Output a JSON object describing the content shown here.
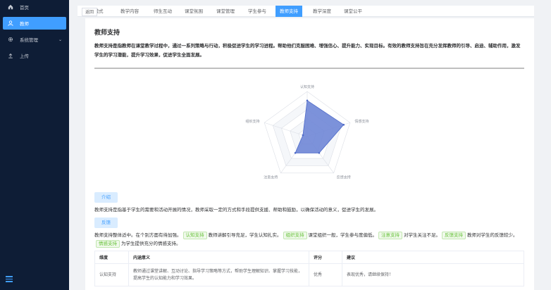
{
  "sidebar": {
    "items": [
      {
        "label": "首页",
        "icon": "home-icon"
      },
      {
        "label": "教师",
        "icon": "user-icon"
      },
      {
        "label": "系统管理",
        "icon": "gear-icon"
      },
      {
        "label": "上传",
        "icon": "upload-icon"
      }
    ]
  },
  "tabs": [
    "学模式",
    "教学内容",
    "师生互动",
    "课堂氛围",
    "课堂管理",
    "学生参与",
    "教师支持",
    "教学深度",
    "课堂公平"
  ],
  "return_label": "返回",
  "page": {
    "title": "教师支持",
    "description": "教师支持是指教师在课堂教学过程中，通过一系列策略与行动，积极促进学生的学习进程。帮助他们克服困难、增强信心、提升能力、实现目标。有效的教师支持旨在充分发挥教师的引导、启迪、辅助作用，激发学生的学习潜能，提升学习效果，促进学生全面发展。"
  },
  "chart_data": {
    "type": "radar",
    "axes": [
      "认知支持",
      "情感支持",
      "反馈支持",
      "注意支持",
      "组织支持"
    ],
    "values": [
      0.8,
      0.85,
      0.45,
      0.45,
      0.1
    ],
    "max": 1,
    "fill": "#6f86d6"
  },
  "intro": {
    "button": "介绍",
    "text": "教师支持是指基于学生的需要和活动开展的情况，教师采取一定的方式和手段提供支援、帮助和鼓励，以确保活动的意义，促进学生的发展。"
  },
  "feedback": {
    "button": "反馈",
    "seg1": "教师支持整体适中。在个别方面有待加强。",
    "tag1": "认知支持",
    "seg2": "教师讲解引导充足，学生认知扎实。",
    "tag2": "组织支持",
    "seg3": "课堂组织一般，学生参与度偏低。",
    "tag3": "注意支持",
    "seg4": "对学生关注不足。",
    "tag4": "反馈支持",
    "seg5": "教师对学生的反馈较少。",
    "tag5": "情感支持",
    "seg6": "为学生提供充分的情感支持。"
  },
  "table": {
    "headers": [
      "维度",
      "内涵意义",
      "评分",
      "建议"
    ],
    "rows": [
      [
        "认知支持",
        "教师通过课堂讲解、互动讨论、指导学习策略等方式，帮助学生理解知识、掌握学习技能，提高学生的认知能力和学习效果。",
        "优秀",
        "表现优秀，请继续保持！"
      ]
    ]
  }
}
